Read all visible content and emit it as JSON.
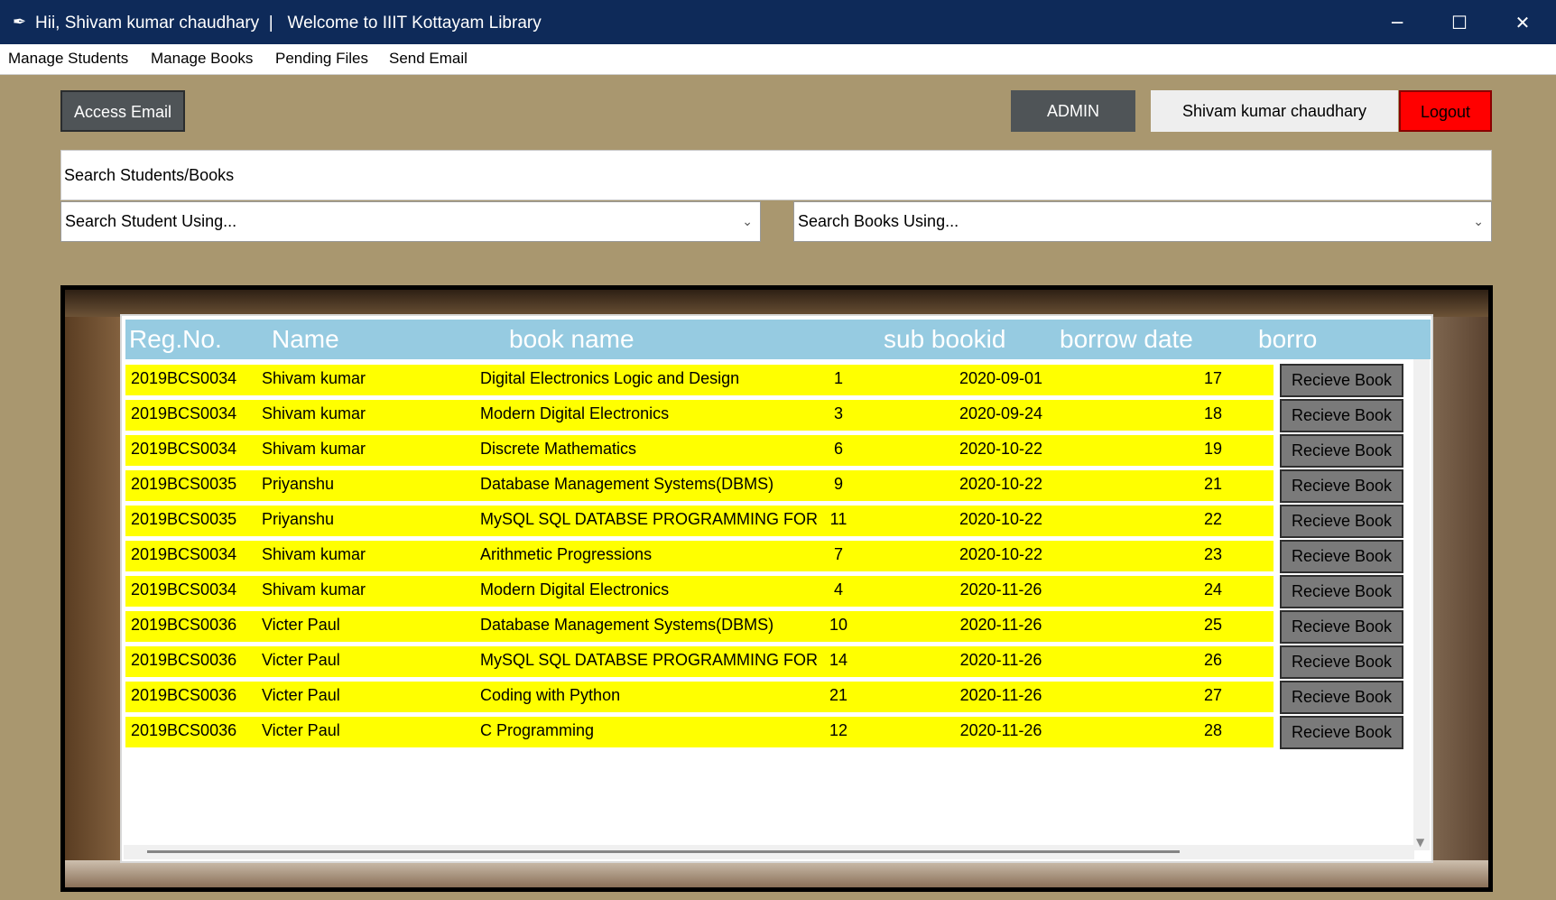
{
  "window": {
    "title": "Hii, Shivam kumar chaudhary  |   Welcome to IIIT Kottayam Library",
    "icon": "feather-icon",
    "controls": [
      "─",
      "☐",
      "✕"
    ]
  },
  "menu": [
    "Manage Students",
    "Manage Books",
    "Pending Files",
    "Send Email"
  ],
  "toolbar": {
    "access_email": "Access Email",
    "role": "ADMIN",
    "user": "Shivam kumar chaudhary",
    "logout": "Logout"
  },
  "search": {
    "value": "Search Students/Books",
    "student_using": "Search Student Using...",
    "books_using": "Search Books Using..."
  },
  "table": {
    "headers": [
      "Reg.No.",
      "Name",
      "book name",
      "sub bookid",
      "borrow date",
      "borro"
    ],
    "action_label": "Recieve Book",
    "rows": [
      [
        "2019BCS0034",
        "Shivam kumar",
        "Digital Electronics Logic and Design",
        "1",
        "2020-09-01",
        "17"
      ],
      [
        "2019BCS0034",
        "Shivam kumar",
        "Modern Digital Electronics",
        "3",
        "2020-09-24",
        "18"
      ],
      [
        "2019BCS0034",
        "Shivam kumar",
        "Discrete Mathematics",
        "6",
        "2020-10-22",
        "19"
      ],
      [
        "2019BCS0035",
        "Priyanshu",
        "Database Management Systems(DBMS)",
        "9",
        "2020-10-22",
        "21"
      ],
      [
        "2019BCS0035",
        "Priyanshu",
        "MySQL SQL DATABSE PROGRAMMING FOR BEʁ",
        "11",
        "2020-10-22",
        "22"
      ],
      [
        "2019BCS0034",
        "Shivam kumar",
        "Arithmetic Progressions",
        "7",
        "2020-10-22",
        "23"
      ],
      [
        "2019BCS0034",
        "Shivam kumar",
        "Modern Digital Electronics",
        "4",
        "2020-11-26",
        "24"
      ],
      [
        "2019BCS0036",
        "Victer Paul",
        "Database Management Systems(DBMS)",
        "10",
        "2020-11-26",
        "25"
      ],
      [
        "2019BCS0036",
        "Victer Paul",
        "MySQL SQL DATABSE PROGRAMMING FOR BEʁ",
        "14",
        "2020-11-26",
        "26"
      ],
      [
        "2019BCS0036",
        "Victer Paul",
        "Coding with Python",
        "21",
        "2020-11-26",
        "27"
      ],
      [
        "2019BCS0036",
        "Victer Paul",
        "C Programming",
        "12",
        "2020-11-26",
        "28"
      ]
    ]
  },
  "colors": {
    "titlebar": "#0e2a59",
    "background": "#a9976f",
    "row_highlight": "#ffff00",
    "header": "#96cbe1",
    "logout": "#ff0000"
  }
}
